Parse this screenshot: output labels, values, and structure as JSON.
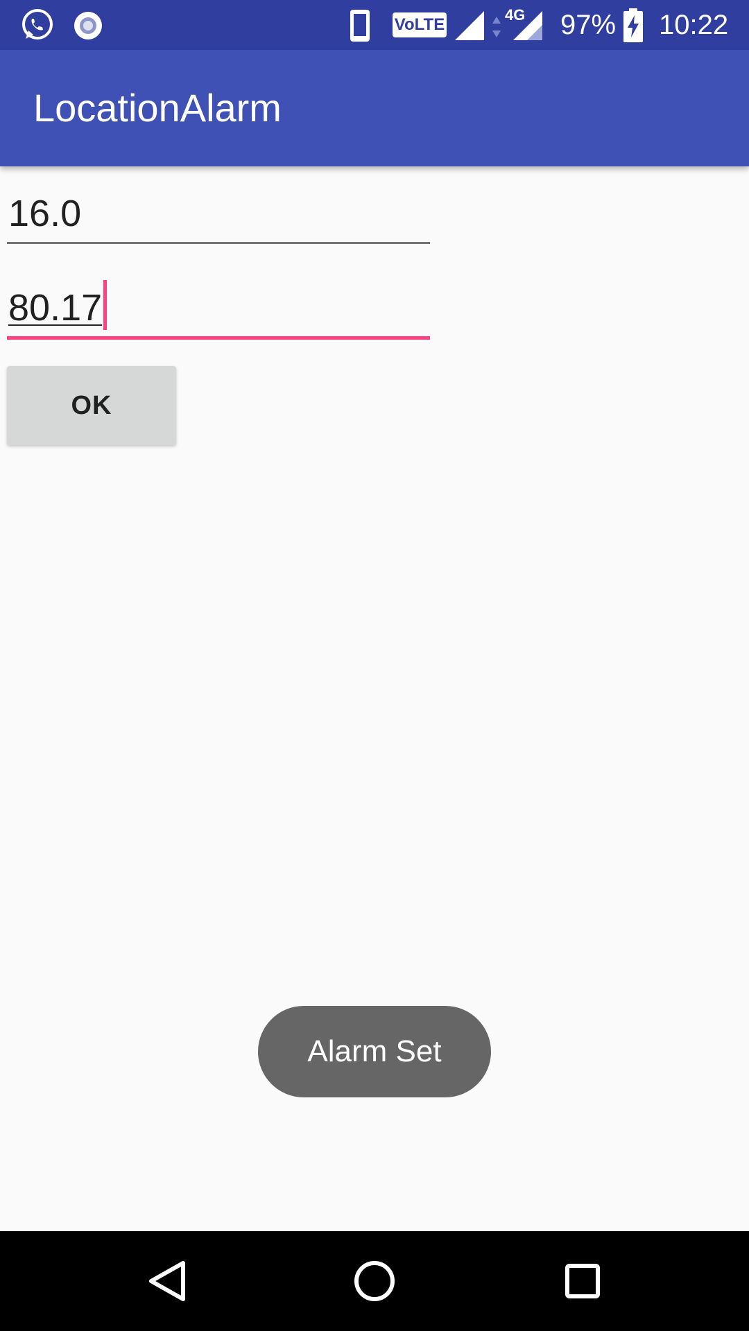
{
  "status_bar": {
    "left_icons": [
      "whatsapp-icon",
      "notification-dot-icon"
    ],
    "right_icons": [
      "phone-icon",
      "volte-icon",
      "signal-icon",
      "data-arrows-icon",
      "4g-signal-icon",
      "battery-charging-icon"
    ],
    "volte_label": "VoLTE",
    "network_label": "4G",
    "battery": "97%",
    "time": "10:22"
  },
  "app_bar": {
    "title": "LocationAlarm",
    "color": "#3f51b5",
    "status_color": "#303f9f"
  },
  "form": {
    "latitude_value": "16.0",
    "longitude_value": "80.17",
    "ok_label": "OK",
    "accent_color": "#ff4081"
  },
  "toast": {
    "message": "Alarm Set"
  },
  "nav_bar": {
    "icons": [
      "back-icon",
      "home-icon",
      "recents-icon"
    ]
  }
}
